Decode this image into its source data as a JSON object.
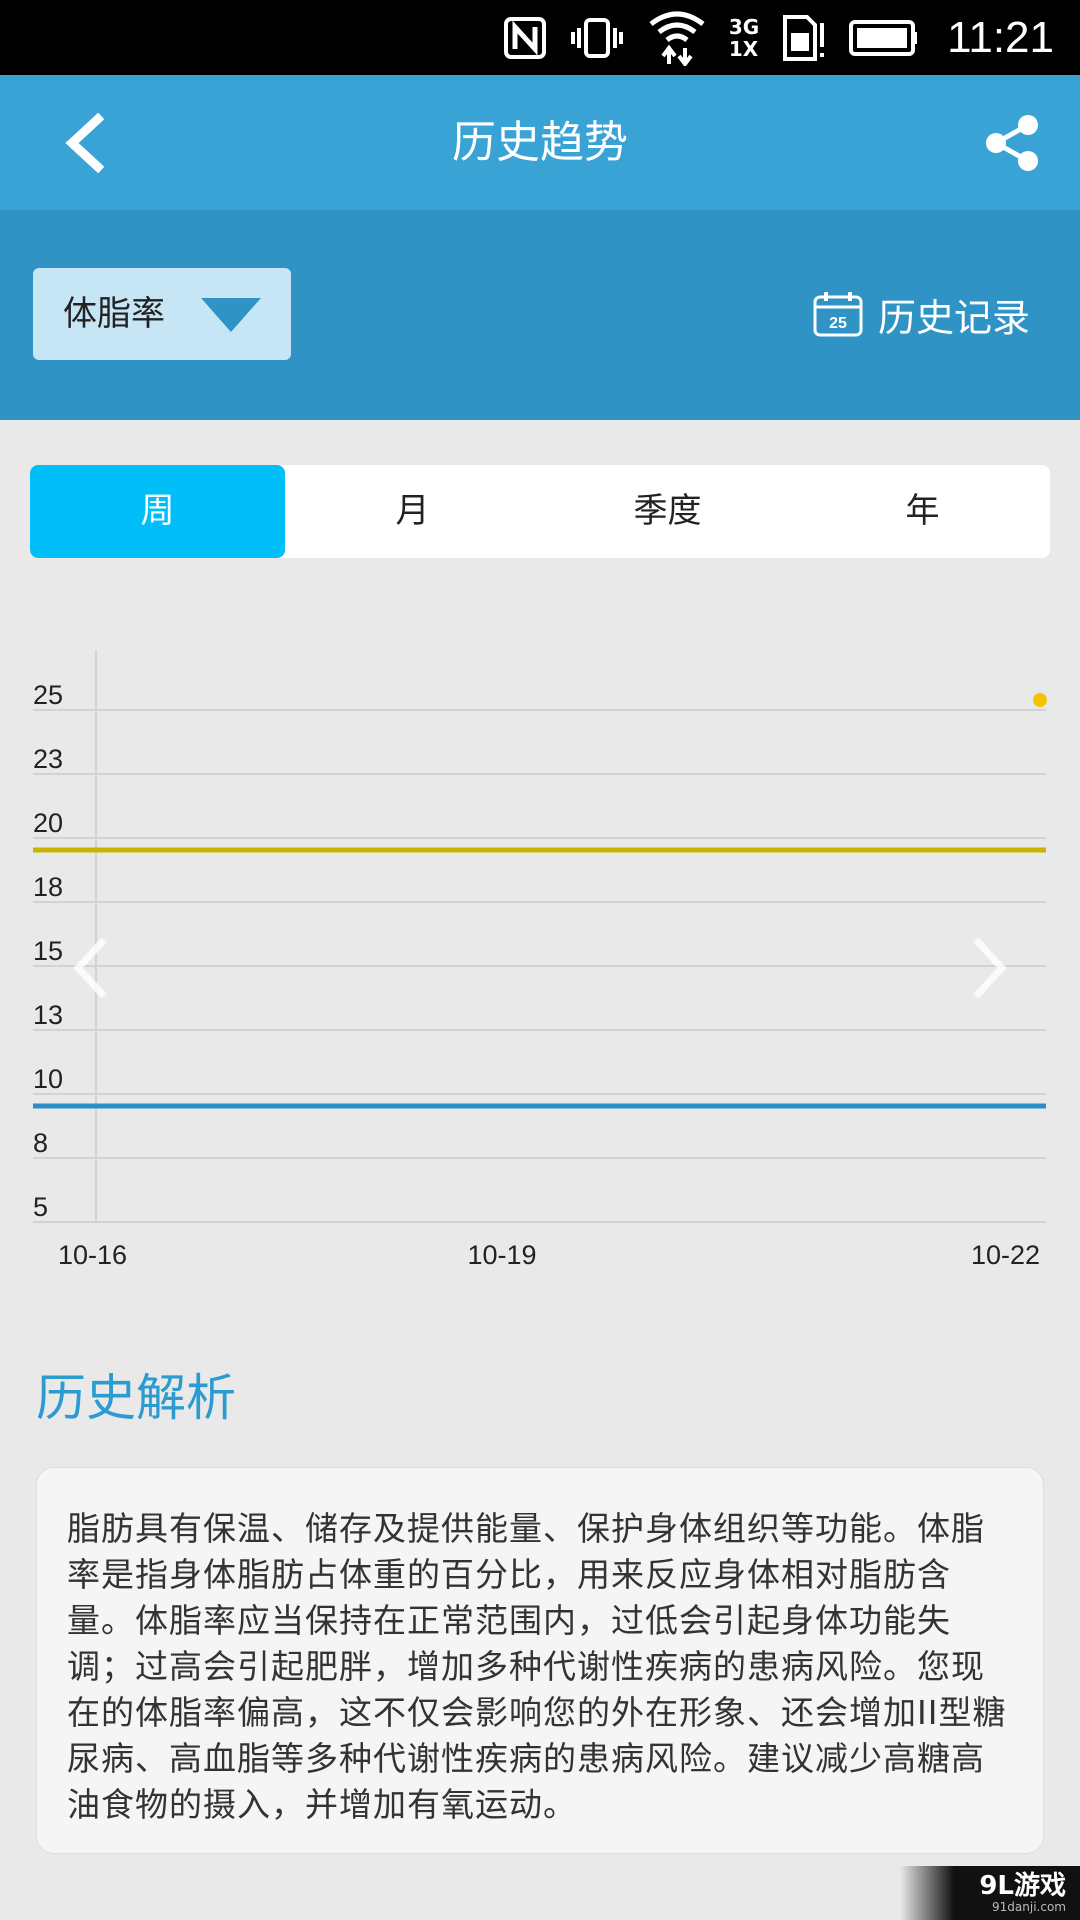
{
  "status_bar": {
    "time": "11:21",
    "network_label_top": "3G",
    "network_label_bottom": "1X",
    "icons": [
      "nfc-icon",
      "vibrate-icon",
      "wifi-icon",
      "signal-icon",
      "sim-alert-icon",
      "battery-icon"
    ]
  },
  "header": {
    "title": "历史趋势",
    "back_icon": "back-arrow-icon",
    "share_icon": "share-icon"
  },
  "toolbar": {
    "metric_selected": "体脂率",
    "history_label": "历史记录",
    "calendar_day": "25"
  },
  "tabs": [
    {
      "label": "周",
      "active": true
    },
    {
      "label": "月",
      "active": false
    },
    {
      "label": "季度",
      "active": false
    },
    {
      "label": "年",
      "active": false
    }
  ],
  "chart_data": {
    "type": "line",
    "y_ticks": [
      "25",
      "23",
      "20",
      "18",
      "15",
      "13",
      "10",
      "8",
      "5"
    ],
    "x_ticks": [
      "10-16",
      "10-19",
      "10-22"
    ],
    "reference_lines": [
      {
        "value": 20,
        "color": "#c8b400"
      },
      {
        "value": 10,
        "color": "#2a8fc6"
      }
    ],
    "series": [
      {
        "color": "#f5c400",
        "points": [
          {
            "x": "10-22",
            "y": 25
          }
        ]
      }
    ],
    "grid": true,
    "nav_prev_icon": "chevron-left-icon",
    "nav_next_icon": "chevron-right-icon"
  },
  "analysis": {
    "title": "历史解析",
    "body": "脂肪具有保温、储存及提供能量、保护身体组织等功能。体脂率是指身体脂肪占体重的百分比，用来反应身体相对脂肪含量。体脂率应当保持在正常范围内，过低会引起身体功能失调；过高会引起肥胖，增加多种代谢性疾病的患病风险。您现在的体脂率偏高，这不仅会影响您的外在形象、还会增加II型糖尿病、高血脂等多种代谢性疾病的患病风险。建议减少高糖高油食物的摄入，并增加有氧运动。"
  },
  "watermark": {
    "main": "9L游戏",
    "sub": "91danji.com"
  }
}
